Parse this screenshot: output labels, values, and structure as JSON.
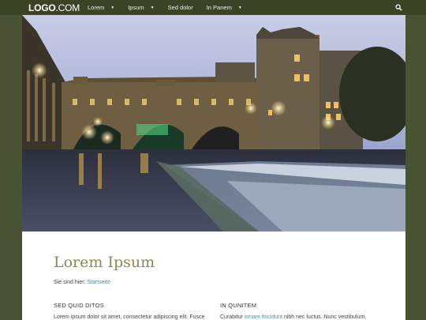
{
  "header": {
    "logo_bold": "LOGO",
    "logo_rest": ".COM",
    "nav": [
      {
        "label": "Lorem",
        "has_dropdown": true
      },
      {
        "label": "Ipsum",
        "has_dropdown": true
      },
      {
        "label": "Sed dolor",
        "has_dropdown": false
      },
      {
        "label": "In Panem",
        "has_dropdown": true
      }
    ],
    "search_icon": "search-icon"
  },
  "main": {
    "title": "Lorem Ipsum",
    "breadcrumb_prefix": "Sie sind hier:",
    "breadcrumb_link": "Startseite",
    "columns": [
      {
        "heading": "SED QUID DITOS",
        "text": "Lorem ipsum dolor sit amet, consectetur adipiscing elit. Fusce"
      },
      {
        "heading": "IN QUNITEM",
        "text_before": "Curabitur",
        "text_link": "ornare tincidunt",
        "text_after": "nibh nec luctus. Nunc vestibulum,"
      }
    ]
  },
  "colors": {
    "page_background": "#4a5234",
    "topbar": "#3b4226",
    "title": "#8a8a4e",
    "link": "#4a8fa8"
  }
}
